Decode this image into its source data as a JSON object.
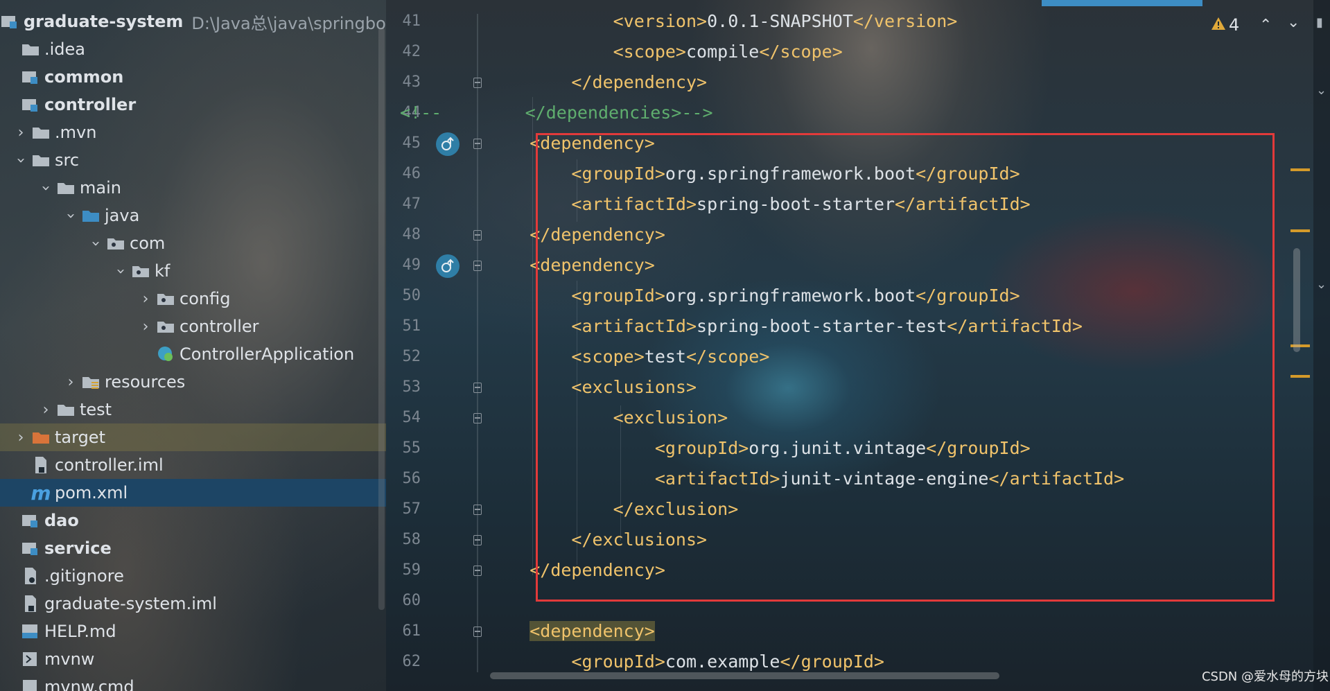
{
  "project_tree": {
    "root": {
      "label": "graduate-system",
      "path": "D:\\Java总\\java\\springboot\\g"
    },
    "items": [
      {
        "label": ".idea"
      },
      {
        "label": "common"
      },
      {
        "label": "controller"
      },
      {
        "label": ".mvn"
      },
      {
        "label": "src"
      },
      {
        "label": "main"
      },
      {
        "label": "java"
      },
      {
        "label": "com"
      },
      {
        "label": "kf"
      },
      {
        "label": "config"
      },
      {
        "label": "controller"
      },
      {
        "label": "ControllerApplication"
      },
      {
        "label": "resources"
      },
      {
        "label": "test"
      },
      {
        "label": "target"
      },
      {
        "label": "controller.iml"
      },
      {
        "label": "pom.xml"
      },
      {
        "label": "dao"
      },
      {
        "label": "service"
      },
      {
        "label": ".gitignore"
      },
      {
        "label": "graduate-system.iml"
      },
      {
        "label": "HELP.md"
      },
      {
        "label": "mvnw"
      },
      {
        "label": "mvnw.cmd"
      }
    ]
  },
  "editor": {
    "warnings_count": "4",
    "lines": [
      {
        "num": "41",
        "indent": "        ",
        "tag1": "<version>",
        "text": "0.0.1-SNAPSHOT",
        "tag2": "</version>"
      },
      {
        "num": "42",
        "indent": "        ",
        "tag1": "<scope>",
        "text": "compile",
        "tag2": "</scope>"
      },
      {
        "num": "43",
        "indent": "    ",
        "tag1": "</dependency>",
        "text": "",
        "tag2": ""
      },
      {
        "num": "44",
        "indent": "",
        "comment_start": "<!--",
        "tag1": "</dependencies>",
        "comment_end": "-->"
      },
      {
        "num": "45",
        "indent": "",
        "tag1": "<dependency>",
        "text": "",
        "tag2": ""
      },
      {
        "num": "46",
        "indent": "    ",
        "tag1": "<groupId>",
        "text": "org.springframework.boot",
        "tag2": "</groupId>"
      },
      {
        "num": "47",
        "indent": "    ",
        "tag1": "<artifactId>",
        "text": "spring-boot-starter",
        "tag2": "</artifactId>"
      },
      {
        "num": "48",
        "indent": "",
        "tag1": "</dependency>",
        "text": "",
        "tag2": ""
      },
      {
        "num": "49",
        "indent": "",
        "tag1": "<dependency>",
        "text": "",
        "tag2": ""
      },
      {
        "num": "50",
        "indent": "    ",
        "tag1": "<groupId>",
        "text": "org.springframework.boot",
        "tag2": "</groupId>"
      },
      {
        "num": "51",
        "indent": "    ",
        "tag1": "<artifactId>",
        "text": "spring-boot-starter-test",
        "tag2": "</artifactId>"
      },
      {
        "num": "52",
        "indent": "    ",
        "tag1": "<scope>",
        "text": "test",
        "tag2": "</scope>"
      },
      {
        "num": "53",
        "indent": "    ",
        "tag1": "<exclusions>",
        "text": "",
        "tag2": ""
      },
      {
        "num": "54",
        "indent": "        ",
        "tag1": "<exclusion>",
        "text": "",
        "tag2": ""
      },
      {
        "num": "55",
        "indent": "            ",
        "tag1": "<groupId>",
        "text": "org.junit.vintage",
        "tag2": "</groupId>"
      },
      {
        "num": "56",
        "indent": "            ",
        "tag1": "<artifactId>",
        "text": "junit-vintage-engine",
        "tag2": "</artifactId>"
      },
      {
        "num": "57",
        "indent": "        ",
        "tag1": "</exclusion>",
        "text": "",
        "tag2": ""
      },
      {
        "num": "58",
        "indent": "    ",
        "tag1": "</exclusions>",
        "text": "",
        "tag2": ""
      },
      {
        "num": "59",
        "indent": "",
        "tag1": "</dependency>",
        "text": "",
        "tag2": ""
      },
      {
        "num": "60",
        "indent": "",
        "tag1": "",
        "text": "",
        "tag2": ""
      },
      {
        "num": "61",
        "indent": "",
        "tag1": "<dependency>",
        "text": "",
        "tag2": ""
      },
      {
        "num": "62",
        "indent": "    ",
        "tag1": "<groupId>",
        "text": "com.example",
        "tag2": "</groupId>"
      }
    ]
  },
  "watermark": "CSDN @爱水母的方块",
  "colors": {
    "tag": "#f0c36b",
    "comment": "#5fae6e",
    "selection_box": "#e23a3a",
    "selected_row": "#1d4565",
    "module_marker": "#3d8dc4"
  },
  "icons": {
    "folder": "folder-icon",
    "module": "module-folder-icon",
    "source_root": "source-root-icon",
    "package": "package-icon",
    "resources": "resources-folder-icon",
    "excluded": "excluded-folder-icon",
    "maven": "maven-icon",
    "spring_class": "spring-class-icon",
    "file": "file-icon",
    "markdown": "markdown-icon",
    "warning": "warning-icon"
  }
}
